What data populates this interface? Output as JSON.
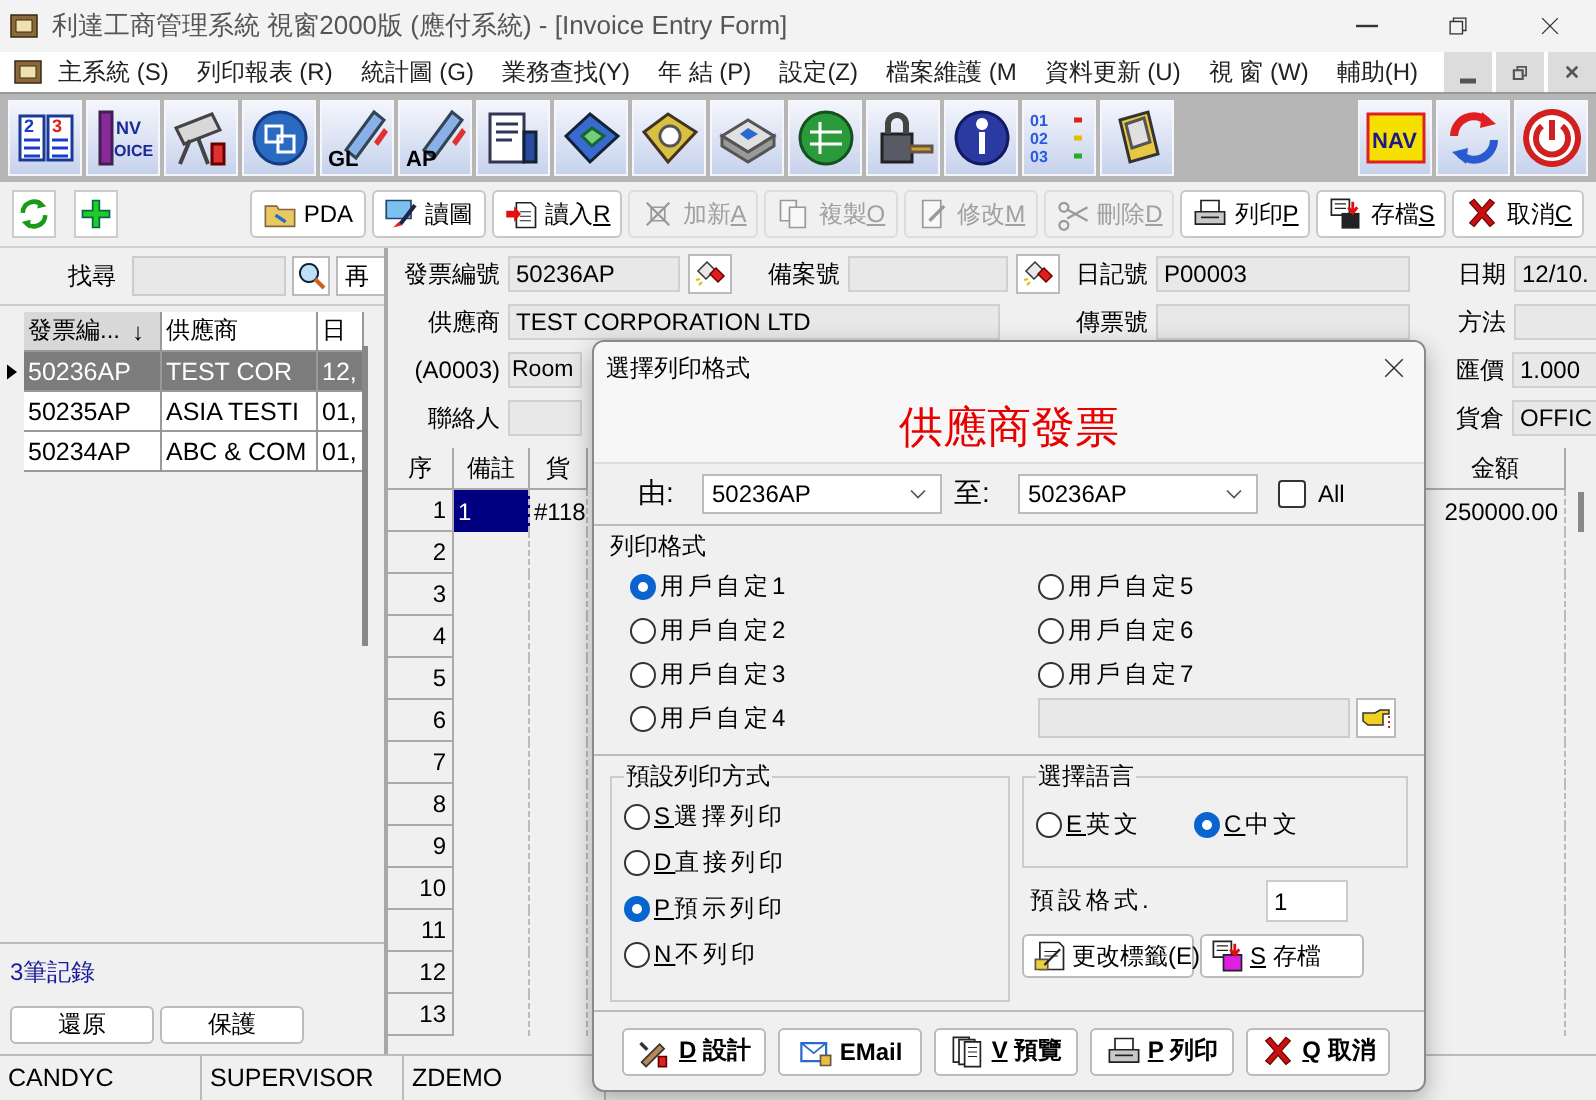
{
  "window": {
    "title": "利達工商管理系統 視窗2000版 (應付系統) - [Invoice Entry Form]"
  },
  "menu": [
    "主系統 (S)",
    "列印報表 (R)",
    "統計圖 (G)",
    "業務查找(Y)",
    "年 結 (P)",
    "設定(Z)",
    "檔案維護 (M",
    "資料更新 (U)",
    "視 窗 (W)",
    "輔助(H)"
  ],
  "main_toolbar": [
    {
      "kind": "book",
      "text": [
        "2",
        "3"
      ]
    },
    {
      "kind": "invoice",
      "text": [
        "NV",
        "OICE"
      ]
    },
    {
      "kind": "telescope"
    },
    {
      "kind": "cubes"
    },
    {
      "kind": "gl",
      "text": [
        "GL"
      ]
    },
    {
      "kind": "ap",
      "text": [
        "AP"
      ]
    },
    {
      "kind": "document"
    },
    {
      "kind": "disk"
    },
    {
      "kind": "cd"
    },
    {
      "kind": "drive"
    },
    {
      "kind": "globe"
    },
    {
      "kind": "lock"
    },
    {
      "kind": "info"
    },
    {
      "kind": "list",
      "text": [
        "01",
        "02",
        "03"
      ]
    },
    {
      "kind": "pda"
    }
  ],
  "main_toolbar_right": [
    {
      "kind": "nav",
      "text": [
        "NAV"
      ]
    },
    {
      "kind": "refresh"
    },
    {
      "kind": "power"
    }
  ],
  "quick_buttons": [
    {
      "kind": "sync"
    },
    {
      "kind": "plus"
    }
  ],
  "toolbar": [
    {
      "kind": "folder",
      "label": "PDA",
      "disabled": false
    },
    {
      "kind": "paint",
      "label": "讀圖",
      "disabled": false
    },
    {
      "kind": "import",
      "label": "讀入",
      "key": "R",
      "disabled": false
    },
    {
      "kind": "new",
      "label": "加新",
      "key": "A",
      "disabled": true
    },
    {
      "kind": "copy",
      "label": "複製",
      "key": "O",
      "disabled": true
    },
    {
      "kind": "edit",
      "label": "修改",
      "key": "M",
      "disabled": true
    },
    {
      "kind": "scissors",
      "label": "刪除",
      "key": "D",
      "disabled": true
    },
    {
      "kind": "print",
      "label": "列印",
      "key": "P",
      "disabled": false
    },
    {
      "kind": "save",
      "label": "存檔",
      "key": "S",
      "disabled": false
    },
    {
      "kind": "cancel",
      "label": "取消",
      "key": "C",
      "disabled": false
    }
  ],
  "finder": {
    "label": "找尋",
    "next_button": "再"
  },
  "invoice_list": {
    "columns": [
      "發票編...",
      "供應商",
      "日"
    ],
    "sort_arrow": "↓",
    "rows": [
      {
        "cells": [
          "50236AP",
          "TEST COR",
          "12,"
        ],
        "selected": true
      },
      {
        "cells": [
          "50235AP",
          "ASIA TESTI",
          "01,"
        ],
        "selected": false
      },
      {
        "cells": [
          "50234AP",
          "ABC & COM",
          "01,"
        ],
        "selected": false
      }
    ]
  },
  "record_count": "3筆記錄",
  "left_buttons": [
    "還原",
    "保護"
  ],
  "form": {
    "invoice_no": {
      "label": "發票編號",
      "value": "50236AP"
    },
    "filing_no": {
      "label": "備案號"
    },
    "journal_no": {
      "label": "日記號",
      "value": "P00003"
    },
    "date": {
      "label": "日期",
      "value": "12/10."
    },
    "supplier": {
      "label": "供應商",
      "value": "TEST CORPORATION LTD"
    },
    "voucher_no": {
      "label": "傳票號"
    },
    "method": {
      "label": "方法"
    },
    "address": {
      "label": "(A0003)",
      "value": "Room"
    },
    "rate": {
      "label": "匯價",
      "value": "1.000"
    },
    "contact": {
      "label": "聯絡人"
    },
    "warehouse": {
      "label": "貨倉",
      "value": "OFFIC"
    }
  },
  "detail_grid": {
    "columns": [
      "序",
      "備註",
      "貨"
    ],
    "amount_column": "金額",
    "rows": [
      {
        "no": "1",
        "note": "1",
        "item": "#118",
        "amount": "250000.00",
        "selected": true
      },
      {
        "no": "2",
        "selected": false
      },
      {
        "no": "3",
        "selected": false
      },
      {
        "no": "4",
        "selected": false
      },
      {
        "no": "5",
        "selected": false
      },
      {
        "no": "6",
        "selected": false
      },
      {
        "no": "7",
        "selected": false
      },
      {
        "no": "8",
        "selected": false
      },
      {
        "no": "9",
        "selected": false
      },
      {
        "no": "10",
        "selected": false
      },
      {
        "no": "11",
        "selected": false
      },
      {
        "no": "12",
        "selected": false
      },
      {
        "no": "13",
        "selected": false
      }
    ]
  },
  "status_bar": [
    "CANDYC",
    "SUPERVISOR",
    "ZDEMO"
  ],
  "dialog": {
    "title": "選擇列印格式",
    "heading": "供應商發票",
    "from": {
      "label": "由:",
      "value": "50236AP"
    },
    "to": {
      "label": "至:",
      "value": "50236AP"
    },
    "all": {
      "label": "All",
      "checked": false
    },
    "format_group": {
      "title": "列印格式",
      "options": [
        {
          "label": "用戶自定1",
          "selected": true
        },
        {
          "label": "用戶自定2",
          "selected": false
        },
        {
          "label": "用戶自定3",
          "selected": false
        },
        {
          "label": "用戶自定4",
          "selected": false
        },
        {
          "label": "用戶自定5",
          "selected": false
        },
        {
          "label": "用戶自定6",
          "selected": false
        },
        {
          "label": "用戶自定7",
          "selected": false
        }
      ]
    },
    "mode_group": {
      "title": "預設列印方式",
      "options": [
        {
          "key": "S",
          "label": "選擇列印",
          "selected": false
        },
        {
          "key": "D",
          "label": "直接列印",
          "selected": false
        },
        {
          "key": "P",
          "label": "預示列印",
          "selected": true
        },
        {
          "key": "N",
          "label": "不列印",
          "selected": false
        }
      ]
    },
    "language_group": {
      "title": "選擇語言",
      "options": [
        {
          "key": "E",
          "label": "英文",
          "selected": false
        },
        {
          "key": "C",
          "label": "中文",
          "selected": true
        }
      ]
    },
    "default_format": {
      "label": "預設格式.",
      "value": "1"
    },
    "side_buttons": [
      {
        "kind": "labeledit",
        "label": "更改標籤(E)"
      },
      {
        "kind": "savepink",
        "key": "S",
        "label": "存檔"
      }
    ],
    "footer_buttons": [
      {
        "kind": "design",
        "key": "D",
        "label": "設計"
      },
      {
        "kind": "email",
        "label": "EMail"
      },
      {
        "kind": "preview",
        "key": "V",
        "label": "預覽"
      },
      {
        "kind": "print",
        "key": "P",
        "label": "列印"
      },
      {
        "kind": "cancel",
        "key": "Q",
        "label": "取消"
      }
    ]
  }
}
